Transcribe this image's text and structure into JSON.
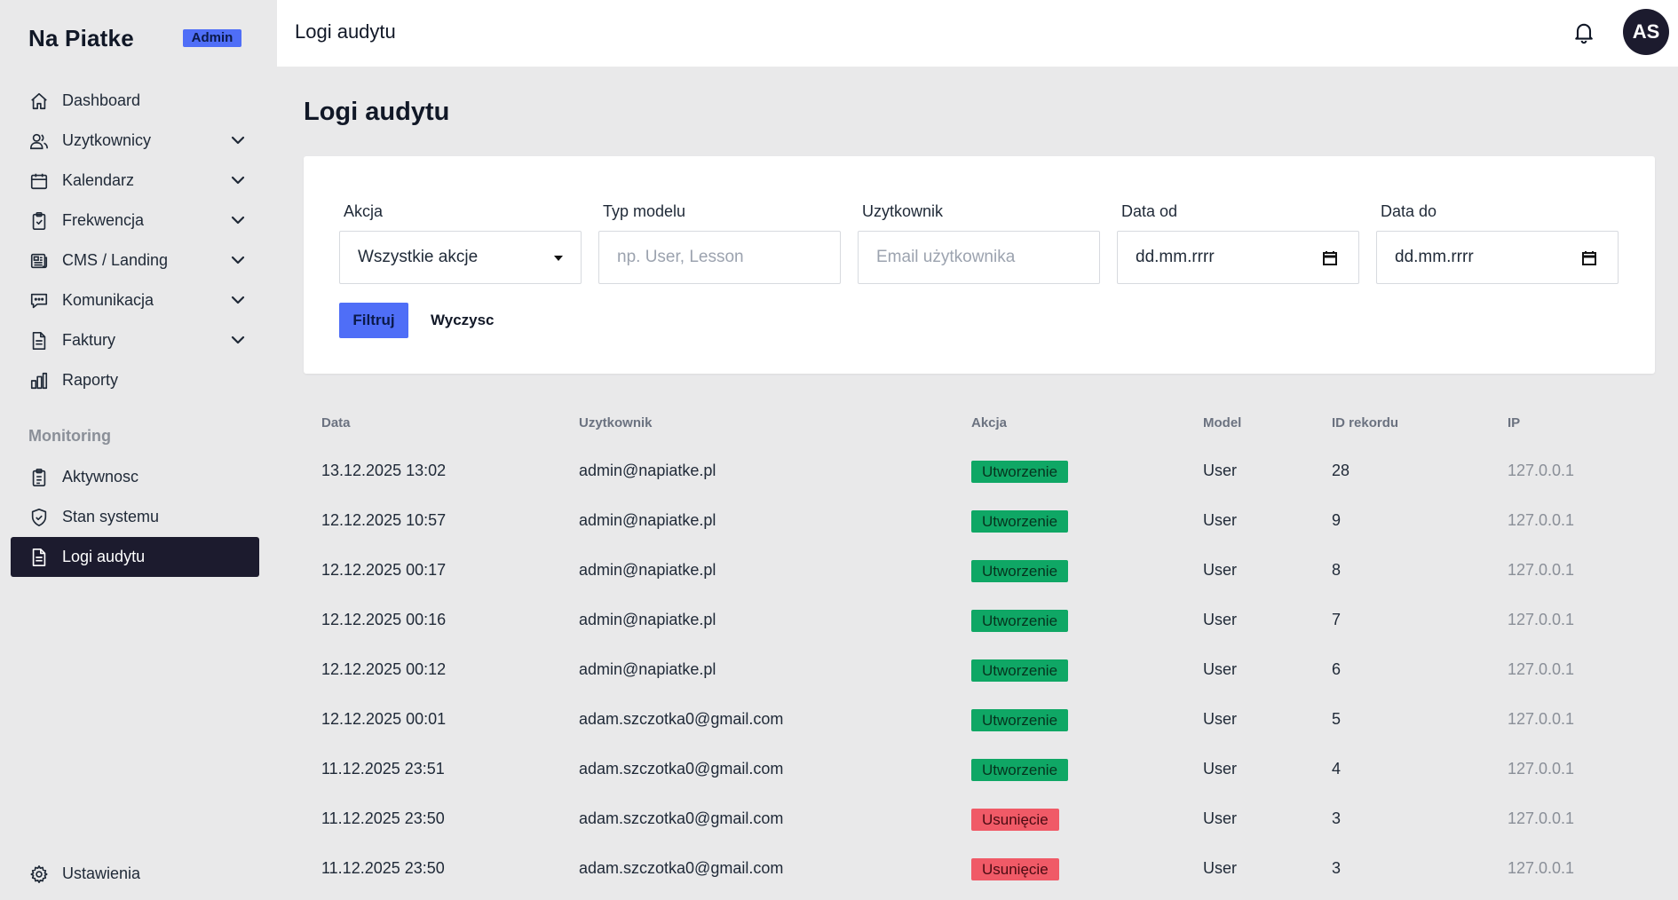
{
  "brand": {
    "name": "Na Piatke",
    "badge": "Admin"
  },
  "sidebar": {
    "items": [
      {
        "label": "Dashboard",
        "icon": "home-icon",
        "expandable": false
      },
      {
        "label": "Uzytkownicy",
        "icon": "users-icon",
        "expandable": true
      },
      {
        "label": "Kalendarz",
        "icon": "calendar-icon",
        "expandable": true
      },
      {
        "label": "Frekwencja",
        "icon": "clipboard-check-icon",
        "expandable": true
      },
      {
        "label": "CMS / Landing",
        "icon": "newspaper-icon",
        "expandable": true
      },
      {
        "label": "Komunikacja",
        "icon": "chat-icon",
        "expandable": true
      },
      {
        "label": "Faktury",
        "icon": "document-icon",
        "expandable": true
      },
      {
        "label": "Raporty",
        "icon": "bar-chart-icon",
        "expandable": false
      }
    ],
    "section_label": "Monitoring",
    "monitoring_items": [
      {
        "label": "Aktywnosc",
        "icon": "clipboard-list-icon",
        "active": false
      },
      {
        "label": "Stan systemu",
        "icon": "shield-check-icon",
        "active": false
      },
      {
        "label": "Logi audytu",
        "icon": "document-text-icon",
        "active": true
      }
    ],
    "settings_label": "Ustawienia"
  },
  "topbar": {
    "title": "Logi audytu",
    "avatar_initials": "AS"
  },
  "page": {
    "title": "Logi audytu"
  },
  "filters": {
    "action_label": "Akcja",
    "action_value": "Wszystkie akcje",
    "model_label": "Typ modelu",
    "model_placeholder": "np. User, Lesson",
    "user_label": "Uzytkownik",
    "user_placeholder": "Email użytkownika",
    "date_from_label": "Data od",
    "date_from_placeholder": "dd.mm.rrrr",
    "date_to_label": "Data do",
    "date_to_placeholder": "dd.mm.rrrr",
    "filter_button": "Filtruj",
    "clear_button": "Wyczysc"
  },
  "table": {
    "headers": {
      "date": "Data",
      "user": "Uzytkownik",
      "action": "Akcja",
      "model": "Model",
      "record_id": "ID rekordu",
      "ip": "IP"
    },
    "rows": [
      {
        "date": "13.12.2025 13:02",
        "user": "admin@napiatke.pl",
        "action": "Utworzenie",
        "type": "create",
        "model": "User",
        "record_id": "28",
        "ip": "127.0.0.1"
      },
      {
        "date": "12.12.2025 10:57",
        "user": "admin@napiatke.pl",
        "action": "Utworzenie",
        "type": "create",
        "model": "User",
        "record_id": "9",
        "ip": "127.0.0.1"
      },
      {
        "date": "12.12.2025 00:17",
        "user": "admin@napiatke.pl",
        "action": "Utworzenie",
        "type": "create",
        "model": "User",
        "record_id": "8",
        "ip": "127.0.0.1"
      },
      {
        "date": "12.12.2025 00:16",
        "user": "admin@napiatke.pl",
        "action": "Utworzenie",
        "type": "create",
        "model": "User",
        "record_id": "7",
        "ip": "127.0.0.1"
      },
      {
        "date": "12.12.2025 00:12",
        "user": "admin@napiatke.pl",
        "action": "Utworzenie",
        "type": "create",
        "model": "User",
        "record_id": "6",
        "ip": "127.0.0.1"
      },
      {
        "date": "12.12.2025 00:01",
        "user": "adam.szczotka0@gmail.com",
        "action": "Utworzenie",
        "type": "create",
        "model": "User",
        "record_id": "5",
        "ip": "127.0.0.1"
      },
      {
        "date": "11.12.2025 23:51",
        "user": "adam.szczotka0@gmail.com",
        "action": "Utworzenie",
        "type": "create",
        "model": "User",
        "record_id": "4",
        "ip": "127.0.0.1"
      },
      {
        "date": "11.12.2025 23:50",
        "user": "adam.szczotka0@gmail.com",
        "action": "Usunięcie",
        "type": "delete",
        "model": "User",
        "record_id": "3",
        "ip": "127.0.0.1"
      },
      {
        "date": "11.12.2025 23:50",
        "user": "adam.szczotka0@gmail.com",
        "action": "Usunięcie",
        "type": "delete",
        "model": "User",
        "record_id": "3",
        "ip": "127.0.0.1"
      }
    ]
  },
  "colors": {
    "accent": "#4f6ef7",
    "active_nav": "#1c1b2e",
    "create": "#0fa765",
    "delete": "#f05a67"
  }
}
